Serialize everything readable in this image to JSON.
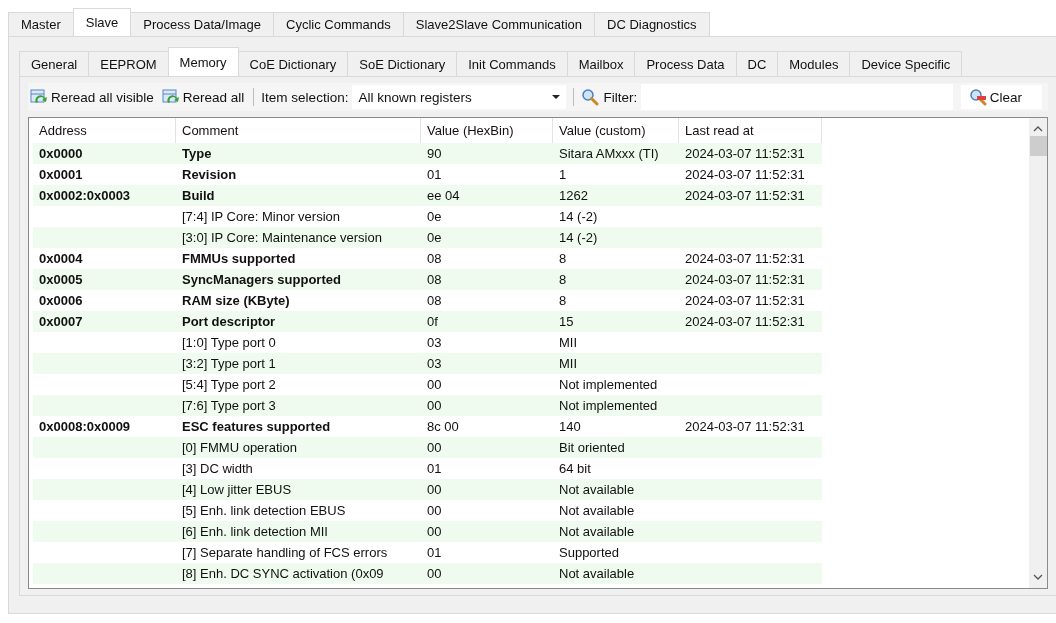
{
  "main_tabs": [
    {
      "label": "Master",
      "selected": false
    },
    {
      "label": "Slave",
      "selected": true
    },
    {
      "label": "Process Data/Image",
      "selected": false
    },
    {
      "label": "Cyclic Commands",
      "selected": false
    },
    {
      "label": "Slave2Slave Communication",
      "selected": false
    },
    {
      "label": "DC Diagnostics",
      "selected": false
    }
  ],
  "sub_tabs": [
    {
      "label": "General",
      "selected": false
    },
    {
      "label": "EEPROM",
      "selected": false
    },
    {
      "label": "Memory",
      "selected": true
    },
    {
      "label": "CoE Dictionary",
      "selected": false
    },
    {
      "label": "SoE Dictionary",
      "selected": false
    },
    {
      "label": "Init Commands",
      "selected": false
    },
    {
      "label": "Mailbox",
      "selected": false
    },
    {
      "label": "Process Data",
      "selected": false
    },
    {
      "label": "DC",
      "selected": false
    },
    {
      "label": "Modules",
      "selected": false
    },
    {
      "label": "Device Specific",
      "selected": false
    }
  ],
  "toolbar": {
    "reread_visible": "Reread all visible",
    "reread_all": "Reread all",
    "item_selection_label": "Item selection:",
    "item_selection_value": "All known registers",
    "filter_label": "Filter:",
    "clear": "Clear"
  },
  "table": {
    "columns": [
      "Address",
      "Comment",
      "Value (HexBin)",
      "Value (custom)",
      "Last read at"
    ],
    "rows": [
      {
        "kind": "register",
        "address": "0x0000",
        "comment": "Type",
        "hex": "90",
        "custom": "Sitara AMxxx (TI)",
        "last_read": "2024-03-07 11:52:31"
      },
      {
        "kind": "register",
        "address": "0x0001",
        "comment": "Revision",
        "hex": "01",
        "custom": "1",
        "last_read": "2024-03-07 11:52:31"
      },
      {
        "kind": "register",
        "address": "0x0002:0x0003",
        "comment": "Build",
        "hex": "ee 04",
        "custom": "1262",
        "last_read": "2024-03-07 11:52:31"
      },
      {
        "kind": "field",
        "comment": "[7:4] IP Core: Minor version",
        "hex": "0e",
        "custom": "14 (-2)"
      },
      {
        "kind": "field",
        "comment": "[3:0] IP Core: Maintenance version",
        "hex": "0e",
        "custom": "14 (-2)"
      },
      {
        "kind": "register",
        "address": "0x0004",
        "comment": "FMMUs supported",
        "hex": "08",
        "custom": "8",
        "last_read": "2024-03-07 11:52:31"
      },
      {
        "kind": "register",
        "address": "0x0005",
        "comment": "SyncManagers supported",
        "hex": "08",
        "custom": "8",
        "last_read": "2024-03-07 11:52:31"
      },
      {
        "kind": "register",
        "address": "0x0006",
        "comment": "RAM size (KByte)",
        "hex": "08",
        "custom": "8",
        "last_read": "2024-03-07 11:52:31"
      },
      {
        "kind": "register",
        "address": "0x0007",
        "comment": "Port descriptor",
        "hex": "0f",
        "custom": "15",
        "last_read": "2024-03-07 11:52:31"
      },
      {
        "kind": "field",
        "comment": "[1:0] Type port 0",
        "hex": "03",
        "custom": "MII"
      },
      {
        "kind": "field",
        "comment": "[3:2] Type port 1",
        "hex": "03",
        "custom": "MII"
      },
      {
        "kind": "field",
        "comment": "[5:4] Type port 2",
        "hex": "00",
        "custom": "Not implemented"
      },
      {
        "kind": "field",
        "comment": "[7:6] Type port 3",
        "hex": "00",
        "custom": "Not implemented"
      },
      {
        "kind": "register",
        "address": "0x0008:0x0009",
        "comment": "ESC features supported",
        "hex": "8c 00",
        "custom": "140",
        "last_read": "2024-03-07 11:52:31"
      },
      {
        "kind": "field",
        "comment": "[0] FMMU operation",
        "hex": "00",
        "custom": "Bit oriented"
      },
      {
        "kind": "field",
        "comment": "[3] DC width",
        "hex": "01",
        "custom": "64 bit"
      },
      {
        "kind": "field",
        "comment": "[4] Low jitter EBUS",
        "hex": "00",
        "custom": "Not available"
      },
      {
        "kind": "field",
        "comment": "[5] Enh. link detection EBUS",
        "hex": "00",
        "custom": "Not available"
      },
      {
        "kind": "field",
        "comment": "[6] Enh. link detection MII",
        "hex": "00",
        "custom": "Not available"
      },
      {
        "kind": "field",
        "comment": "[7] Separate handling of FCS errors",
        "hex": "01",
        "custom": "Supported"
      },
      {
        "kind": "field",
        "comment": "[8] Enh. DC SYNC activation (0x09",
        "hex": "00",
        "custom": "Not available"
      }
    ]
  }
}
